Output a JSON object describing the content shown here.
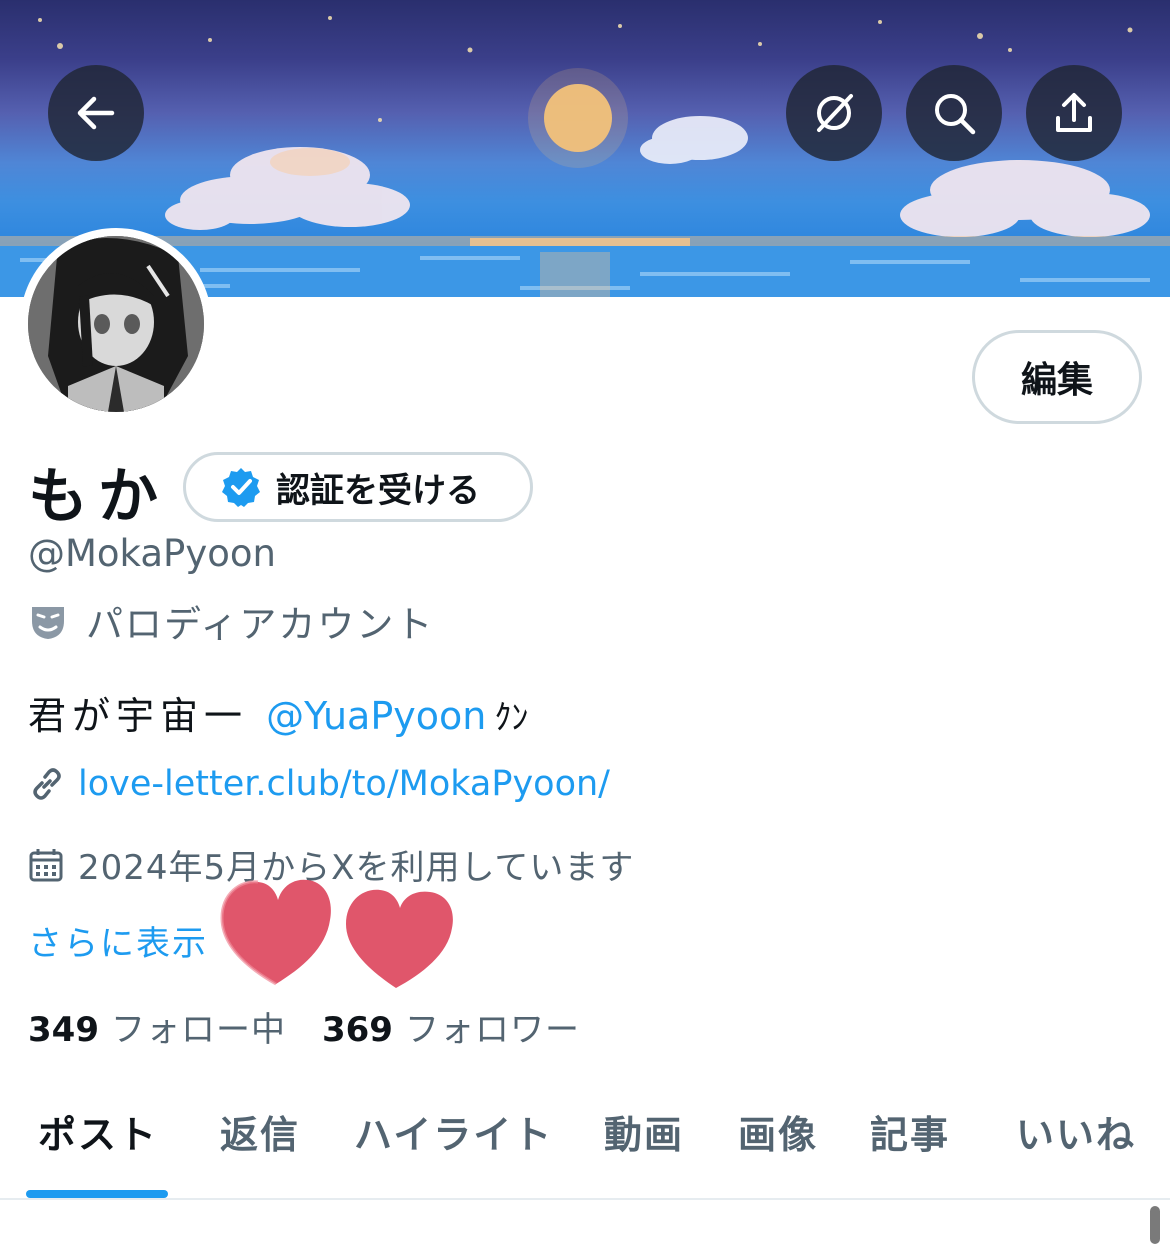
{
  "profile": {
    "display_name": "もか",
    "handle": "@MokaPyoon",
    "verify_label": "認証を受ける",
    "edit_label": "編集",
    "parody_label": "パロディアカウント",
    "bio_text": "君が宇宙一",
    "bio_mention": "@YuaPyoon",
    "bio_tail": "ｸﾝ",
    "url": "love-letter.club/to/MokaPyoon/",
    "joined": "2024年5月からXを利用しています",
    "more_label": "さらに表示",
    "following_count": "349",
    "following_label": "フォロー中",
    "followers_count": "369",
    "followers_label": "フォロワー"
  },
  "tabs": [
    {
      "label": "ポスト",
      "active": true
    },
    {
      "label": "返信",
      "active": false
    },
    {
      "label": "ハイライト",
      "active": false
    },
    {
      "label": "動画",
      "active": false
    },
    {
      "label": "画像",
      "active": false
    },
    {
      "label": "記事",
      "active": false
    },
    {
      "label": "いいね",
      "active": false
    }
  ],
  "icons": {
    "back": "arrow-left-icon",
    "grok": "slash-circle-icon",
    "search": "search-icon",
    "share": "share-icon",
    "verified": "verified-badge-icon",
    "parody": "theater-mask-icon",
    "link": "link-icon",
    "calendar": "calendar-icon"
  },
  "colors": {
    "accent": "#1d9bf0",
    "text_primary": "#0f1419",
    "text_secondary": "#536471",
    "heart": "#e05a6e"
  }
}
